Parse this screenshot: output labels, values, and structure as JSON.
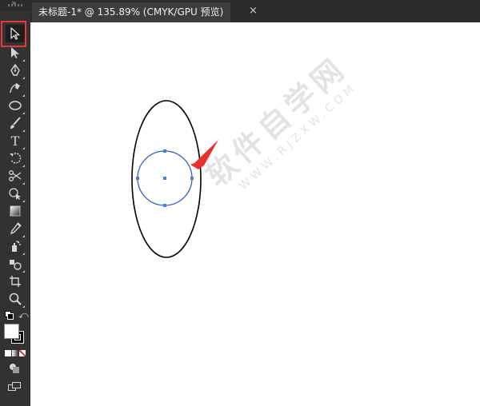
{
  "document_tab": {
    "title": "未标题-1* @ 135.89% (CMYK/GPU 预览)",
    "close_glyph": "×"
  },
  "toolbar": {
    "collapse_glyph": "»",
    "tools": [
      {
        "name": "selection-tool",
        "icon": "arrow-icon",
        "selected": true
      },
      {
        "name": "direct-selection-tool",
        "icon": "direct-arrow-icon"
      },
      {
        "name": "pen-tool",
        "icon": "pen-icon"
      },
      {
        "name": "curvature-tool",
        "icon": "curvature-pen-icon"
      },
      {
        "name": "ellipse-tool",
        "icon": "ellipse-icon"
      },
      {
        "name": "paintbrush-tool",
        "icon": "brush-icon"
      },
      {
        "name": "type-tool",
        "icon": "type-icon",
        "label": "T"
      },
      {
        "name": "rotate-tool",
        "icon": "rotate-icon"
      },
      {
        "name": "scissors-tool",
        "icon": "scissors-icon"
      },
      {
        "name": "shape-builder-tool",
        "icon": "shape-builder-icon"
      },
      {
        "name": "gradient-tool",
        "icon": "gradient-icon"
      },
      {
        "name": "eyedropper-tool",
        "icon": "eyedropper-icon"
      },
      {
        "name": "symbol-sprayer-tool",
        "icon": "sprayer-icon"
      },
      {
        "name": "graph-tool",
        "icon": "graph-icon"
      },
      {
        "name": "artboard-tool",
        "icon": "artboard-icon"
      },
      {
        "name": "zoom-tool",
        "icon": "magnifier-icon"
      }
    ],
    "fill_color": "#ffffff",
    "stroke_color": "#000000"
  },
  "canvas": {
    "background": "#ffffff",
    "outer_ellipse_stroke": "#000000",
    "inner_circle_stroke": "#2f5fc8",
    "anchor_color": "#4a7fe0",
    "arrow_color": "#e8302e",
    "watermark": {
      "main": "软件自学网",
      "sub": "WWW.RJZXW.COM"
    }
  },
  "annotation": {
    "highlight_color": "#e53935"
  }
}
